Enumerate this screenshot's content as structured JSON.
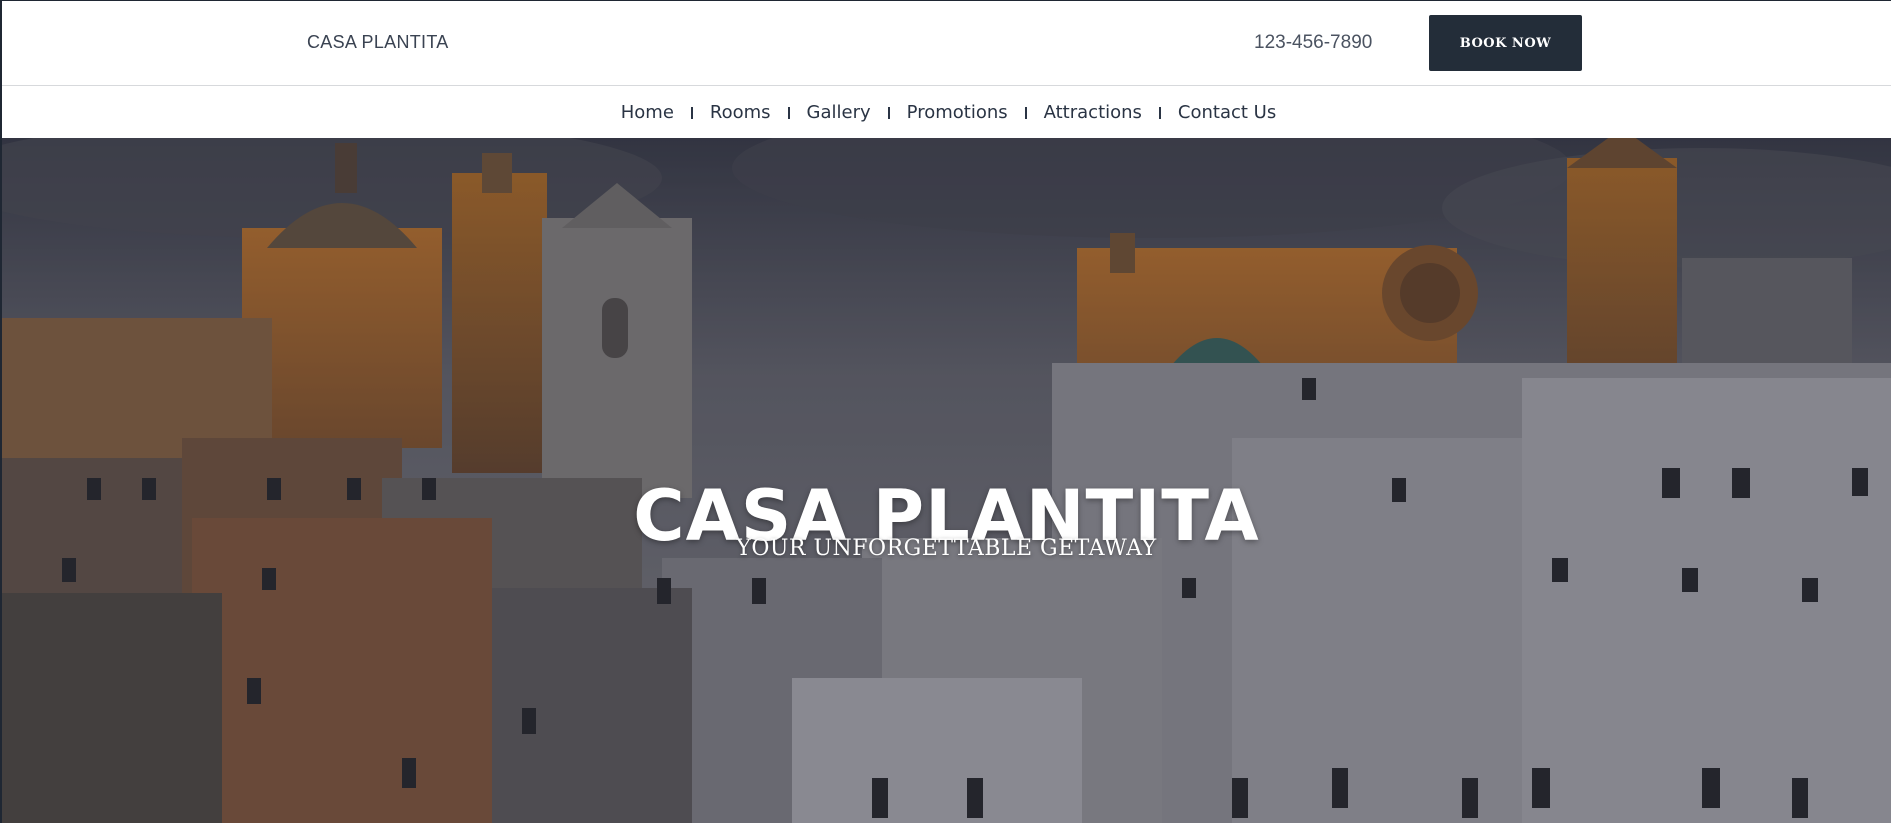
{
  "header": {
    "brand": "CASA PLANTITA",
    "phone": "123-456-7890",
    "book_button": "BOOK NOW"
  },
  "nav": {
    "items": [
      {
        "label": "Home"
      },
      {
        "label": "Rooms"
      },
      {
        "label": "Gallery"
      },
      {
        "label": "Promotions"
      },
      {
        "label": "Attractions"
      },
      {
        "label": "Contact Us"
      }
    ]
  },
  "hero": {
    "title": "CASA PLANTITA",
    "subtitle": "YOUR UNFORGETTABLE GETAWAY",
    "image_subject": "hilltop-town-at-sunset"
  },
  "colors": {
    "button_bg": "#232d39",
    "nav_text": "#2a3444",
    "hero_text": "#ffffff"
  }
}
